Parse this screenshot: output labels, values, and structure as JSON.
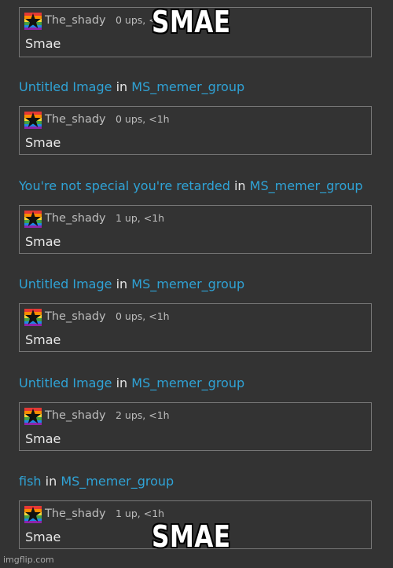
{
  "top_caption": "SMAE",
  "bottom_caption": "SMAE",
  "watermark": "imgflip.com",
  "colors": {
    "background": "#333333",
    "link": "#2fa3d6",
    "border": "#777777",
    "text": "#e9e9e9",
    "muted": "#bdbdbd",
    "caption_fill": "#ffffff",
    "caption_outline": "#000000"
  },
  "avatar_icon": "rainbow-star-avatar-icon",
  "posts": [
    {
      "title": "",
      "in_text": "",
      "group": "",
      "comment": {
        "username": "The_shady",
        "meta": "0 ups, <",
        "text": "Smae"
      }
    },
    {
      "title": "Untitled Image",
      "in_text": "in",
      "group": "MS_memer_group",
      "comment": {
        "username": "The_shady",
        "meta": "0 ups, <1h",
        "text": "Smae"
      }
    },
    {
      "title": "You're not special you're retarded",
      "in_text": "in",
      "group": "MS_memer_group",
      "comment": {
        "username": "The_shady",
        "meta": "1 up, <1h",
        "text": "Smae"
      }
    },
    {
      "title": "Untitled Image",
      "in_text": "in",
      "group": "MS_memer_group",
      "comment": {
        "username": "The_shady",
        "meta": "0 ups, <1h",
        "text": "Smae"
      }
    },
    {
      "title": "Untitled Image",
      "in_text": "in",
      "group": "MS_memer_group",
      "comment": {
        "username": "The_shady",
        "meta": "2 ups, <1h",
        "text": "Smae"
      }
    },
    {
      "title": "fish",
      "in_text": "in",
      "group": "MS_memer_group",
      "comment": {
        "username": "The_shady",
        "meta": "1 up, <1h",
        "text": "Smae"
      }
    }
  ]
}
